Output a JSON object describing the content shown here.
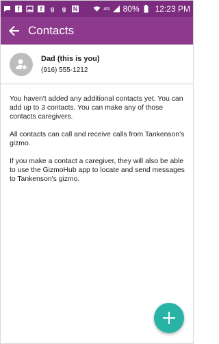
{
  "status_bar": {
    "battery": "80%",
    "time": "12:23 PM",
    "network_label": "4G",
    "icons": [
      "messages-icon",
      "facebook-icon",
      "image-icon",
      "facebook-icon",
      "g-icon",
      "g-icon",
      "n-icon",
      "wifi-icon",
      "signal-icon",
      "battery-icon"
    ]
  },
  "app_bar": {
    "title": "Contacts",
    "back_icon": "arrow-left-icon"
  },
  "contact": {
    "name": "Dad (this is you)",
    "phone": "(916) 555-1212",
    "avatar_icon": "person-star-icon"
  },
  "info": {
    "paragraph1": "You haven't added any additional contacts yet. You can add up to 3 contacts. You can make any of those contacts caregivers.",
    "paragraph2": "All contacts can call and receive calls from Tankenson's gizmo.",
    "paragraph3": "If you make a contact a caregiver, they will also be able to use the GizmoHub app to locate and send messages to Tankenson's gizmo."
  },
  "fab": {
    "icon": "plus-icon"
  },
  "colors": {
    "status_bar": "#7b2c7e",
    "app_bar": "#8e3a8c",
    "fab": "#29b3a6",
    "avatar": "#bdbdbd"
  }
}
